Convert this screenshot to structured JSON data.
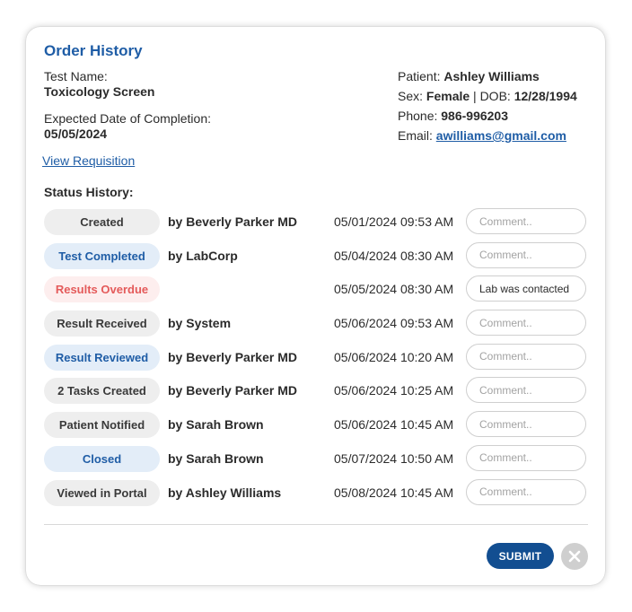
{
  "header": {
    "title": "Order History"
  },
  "test": {
    "name_label": "Test Name:",
    "name_value": "Toxicology Screen",
    "date_label": "Expected Date of Completion:",
    "date_value": "05/05/2024"
  },
  "patient": {
    "patient_label": "Patient:",
    "patient_value": "Ashley Williams",
    "sex_label": "Sex:",
    "sex_value": "Female",
    "dob_sep": " | DOB:",
    "dob_value": "12/28/1994",
    "phone_label": "Phone:",
    "phone_value": "986-996203",
    "email_label": "Email:",
    "email_value": "awilliams@gmail.com"
  },
  "links": {
    "view_requisition": "View Requisition"
  },
  "status": {
    "heading": "Status History:",
    "rows": [
      {
        "status": "Created",
        "style": "gray",
        "by": "by Beverly Parker MD",
        "time": "05/01/2024 09:53 AM",
        "comment": "",
        "placeholder": "Comment.."
      },
      {
        "status": "Test Completed",
        "style": "blue",
        "by": "by LabCorp",
        "time": "05/04/2024 08:30 AM",
        "comment": "",
        "placeholder": "Comment.."
      },
      {
        "status": "Results Overdue",
        "style": "red",
        "by": "",
        "time": "05/05/2024 08:30 AM",
        "comment": "Lab was contacted",
        "placeholder": "Comment.."
      },
      {
        "status": "Result Received",
        "style": "gray",
        "by": "by System",
        "time": "05/06/2024 09:53 AM",
        "comment": "",
        "placeholder": "Comment.."
      },
      {
        "status": "Result Reviewed",
        "style": "blue",
        "by": "by Beverly Parker MD",
        "time": "05/06/2024 10:20 AM",
        "comment": "",
        "placeholder": "Comment.."
      },
      {
        "status": "2 Tasks Created",
        "style": "gray",
        "by": "by Beverly Parker MD",
        "time": "05/06/2024 10:25 AM",
        "comment": "",
        "placeholder": "Comment.."
      },
      {
        "status": "Patient Notified",
        "style": "gray",
        "by": "by Sarah Brown",
        "time": "05/06/2024 10:45 AM",
        "comment": "",
        "placeholder": "Comment.."
      },
      {
        "status": "Closed",
        "style": "blue",
        "by": "by Sarah Brown",
        "time": "05/07/2024 10:50 AM",
        "comment": "",
        "placeholder": "Comment.."
      },
      {
        "status": "Viewed in Portal",
        "style": "gray",
        "by": "by Ashley Williams",
        "time": "05/08/2024 10:45 AM",
        "comment": "",
        "placeholder": "Comment.."
      }
    ]
  },
  "footer": {
    "submit_label": "SUBMIT",
    "close_icon": "close-icon"
  },
  "colors": {
    "accent": "#1f5da6",
    "submit_bg": "#124e91",
    "pill_gray": "#eeeeee",
    "pill_blue": "#e3edf8",
    "pill_red": "#fdeeee",
    "pill_red_text": "#e45a5a"
  }
}
